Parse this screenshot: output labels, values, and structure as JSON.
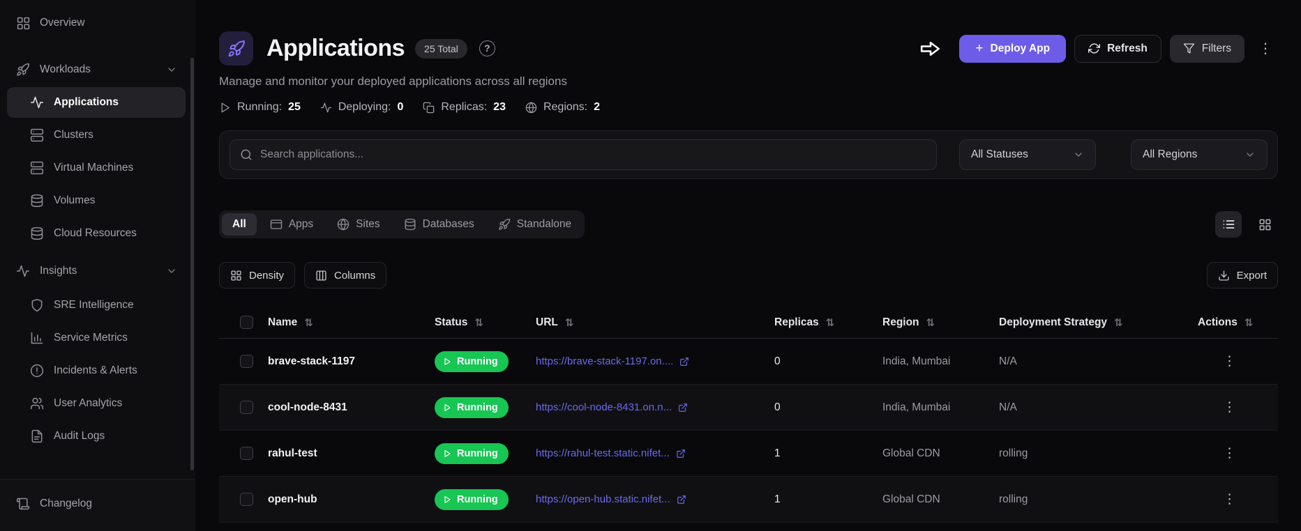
{
  "sidebar": {
    "items": [
      {
        "label": "Overview",
        "icon": "dashboard-grid-icon",
        "level": 0,
        "active": false
      },
      {
        "label": "Workloads",
        "icon": "rocket-icon",
        "level": 0,
        "active": false,
        "chevron": "chevron-down-icon"
      },
      {
        "label": "Applications",
        "icon": "activity-icon",
        "level": 1,
        "active": true
      },
      {
        "label": "Clusters",
        "icon": "server-icon",
        "level": 1,
        "active": false
      },
      {
        "label": "Virtual Machines",
        "icon": "server-icon",
        "level": 1,
        "active": false
      },
      {
        "label": "Volumes",
        "icon": "database-icon",
        "level": 1,
        "active": false
      },
      {
        "label": "Cloud Resources",
        "icon": "database-icon",
        "level": 1,
        "active": false
      },
      {
        "label": "Insights",
        "icon": "activity-icon",
        "level": 0,
        "active": false,
        "chevron": "chevron-down-icon"
      },
      {
        "label": "SRE Intelligence",
        "icon": "shield-icon",
        "level": 1,
        "active": false
      },
      {
        "label": "Service Metrics",
        "icon": "bar-chart-icon",
        "level": 1,
        "active": false
      },
      {
        "label": "Incidents & Alerts",
        "icon": "alert-circle-icon",
        "level": 1,
        "active": false
      },
      {
        "label": "User Analytics",
        "icon": "users-icon",
        "level": 1,
        "active": false
      },
      {
        "label": "Audit Logs",
        "icon": "file-text-icon",
        "level": 1,
        "active": false
      }
    ],
    "footer": {
      "label": "Changelog",
      "icon": "scroll-icon"
    }
  },
  "header": {
    "title": "Applications",
    "title_icon": "rocket-icon",
    "total_badge": "25 Total",
    "help_icon_text": "?",
    "subtitle": "Manage and monitor your deployed applications across all regions",
    "actions": {
      "deploy": {
        "label": "Deploy App",
        "icon": "plus-icon",
        "plus": "+"
      },
      "refresh": {
        "label": "Refresh",
        "icon": "refresh-icon"
      },
      "filters": {
        "label": "Filters",
        "icon": "funnel-icon"
      },
      "more_icon": "kebab-menu-icon",
      "pointer_icon": "cursor-arrow-icon"
    }
  },
  "stats": [
    {
      "label": "Running:",
      "value": "25",
      "icon": "play-icon"
    },
    {
      "label": "Deploying:",
      "value": "0",
      "icon": "activity-icon"
    },
    {
      "label": "Replicas:",
      "value": "23",
      "icon": "copy-icon"
    },
    {
      "label": "Regions:",
      "value": "2",
      "icon": "globe-icon"
    }
  ],
  "search": {
    "placeholder": "Search applications...",
    "icon": "search-icon",
    "status_filter": "All Statuses",
    "region_filter": "All Regions"
  },
  "tabs": [
    {
      "label": "All",
      "active": true
    },
    {
      "label": "Apps",
      "icon": "window-icon"
    },
    {
      "label": "Sites",
      "icon": "globe-icon"
    },
    {
      "label": "Databases",
      "icon": "database-icon"
    },
    {
      "label": "Standalone",
      "icon": "rocket-icon"
    }
  ],
  "toolbar": {
    "density": {
      "label": "Density",
      "icon": "density-grid-icon"
    },
    "columns": {
      "label": "Columns",
      "icon": "columns-icon"
    },
    "export": {
      "label": "Export",
      "icon": "download-icon"
    },
    "view_list_icon": "list-view-icon",
    "view_grid_icon": "grid-view-icon"
  },
  "table": {
    "columns": [
      "Name",
      "Status",
      "URL",
      "Replicas",
      "Region",
      "Deployment Strategy",
      "Actions"
    ],
    "sort_icon": "⇅",
    "row_action_icon": "⋮",
    "rows": [
      {
        "name": "brave-stack-1197",
        "status": "Running",
        "url": "https://brave-stack-1197.on....",
        "replicas": "0",
        "region": "India, Mumbai",
        "strategy": "N/A"
      },
      {
        "name": "cool-node-8431",
        "status": "Running",
        "url": "https://cool-node-8431.on.n...",
        "replicas": "0",
        "region": "India, Mumbai",
        "strategy": "N/A"
      },
      {
        "name": "rahul-test",
        "status": "Running",
        "url": "https://rahul-test.static.nifet...",
        "replicas": "1",
        "region": "Global CDN",
        "strategy": "rolling"
      },
      {
        "name": "open-hub",
        "status": "Running",
        "url": "https://open-hub.static.nifet...",
        "replicas": "1",
        "region": "Global CDN",
        "strategy": "rolling"
      }
    ]
  },
  "colors": {
    "accent": "#6d5ce8",
    "status_running": "#17c653",
    "link": "#6a69ee"
  }
}
